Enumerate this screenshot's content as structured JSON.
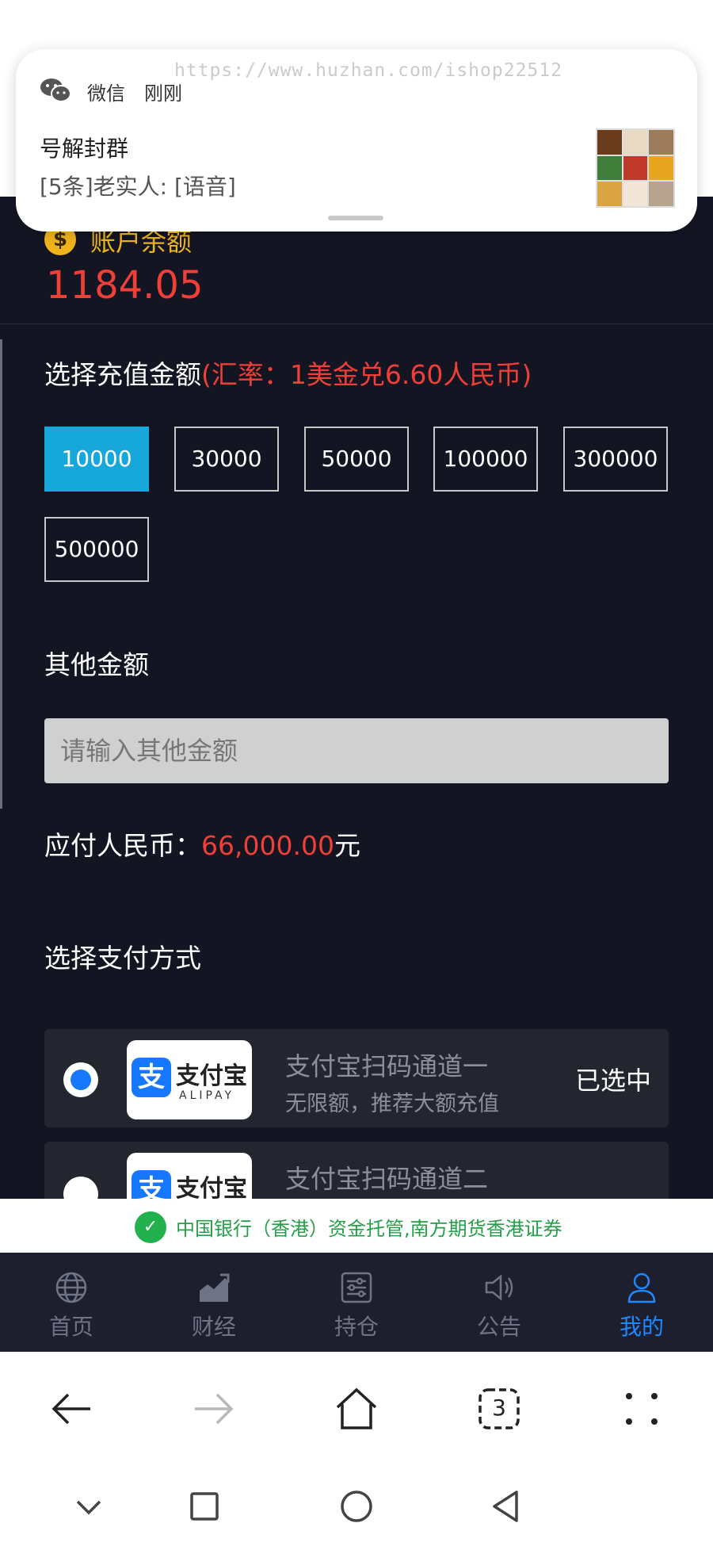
{
  "watermark": "https://www.huzhan.com/ishop22512",
  "notification": {
    "app": "微信",
    "time": "刚刚",
    "title": "号解封群",
    "body": "[5条]老实人: [语音]"
  },
  "account": {
    "label": "账户余额",
    "balance": "1184.05",
    "coin_symbol": "$"
  },
  "recharge": {
    "label": "选择充值金额",
    "rate": "(汇率：1美金兑6.60人民币)",
    "amounts": [
      "10000",
      "30000",
      "50000",
      "100000",
      "300000",
      "500000"
    ],
    "selected_amount": "10000",
    "other_label": "其他金额",
    "other_placeholder": "请输入其他金额",
    "payable_label": "应付人民币：",
    "payable_value": "66,000.00",
    "payable_unit": "元"
  },
  "payment": {
    "label": "选择支付方式",
    "logo_cn": "支付宝",
    "logo_en": "ALIPAY",
    "logo_mark": "支",
    "channels": [
      {
        "title": "支付宝扫码通道一",
        "subtitle": "无限额，推荐大额充值",
        "state": "已选中",
        "selected": true
      },
      {
        "title": "支付宝扫码通道二",
        "subtitle": "",
        "state": "",
        "selected": false
      }
    ]
  },
  "banner": {
    "text": "中国银行（香港）资金托管,南方期货香港证券"
  },
  "tabs": [
    {
      "label": "首页",
      "icon": "globe-icon"
    },
    {
      "label": "财经",
      "icon": "finance-chart-icon"
    },
    {
      "label": "持仓",
      "icon": "holdings-icon"
    },
    {
      "label": "公告",
      "icon": "speaker-icon"
    },
    {
      "label": "我的",
      "icon": "user-icon",
      "active": true
    }
  ],
  "browser": {
    "tab_count": "3"
  },
  "colors": {
    "background": "#131523",
    "accent_red": "#ef3f36",
    "accent_gold": "#f1b51c",
    "selected_blue": "#16a8db",
    "active_tab": "#1e88ff",
    "alipay_blue": "#1677ff"
  }
}
